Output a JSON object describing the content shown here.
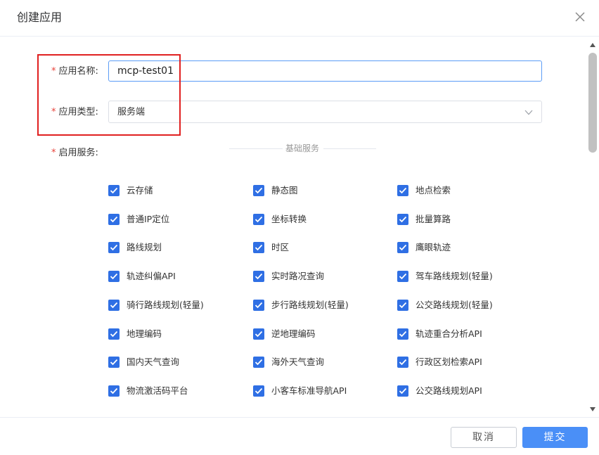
{
  "dialog": {
    "title": "创建应用"
  },
  "form": {
    "app_name_label": "应用名称:",
    "app_name_value": "mcp-test01",
    "app_type_label": "应用类型:",
    "app_type_value": "服务端",
    "services_label": "启用服务:",
    "required_mark": "*"
  },
  "services": {
    "section_title": "基础服务",
    "items": [
      {
        "label": "云存储",
        "checked": true
      },
      {
        "label": "静态图",
        "checked": true
      },
      {
        "label": "地点检索",
        "checked": true
      },
      {
        "label": "普通IP定位",
        "checked": true
      },
      {
        "label": "坐标转换",
        "checked": true
      },
      {
        "label": "批量算路",
        "checked": true
      },
      {
        "label": "路线规划",
        "checked": true
      },
      {
        "label": "时区",
        "checked": true
      },
      {
        "label": "鹰眼轨迹",
        "checked": true
      },
      {
        "label": "轨迹纠偏API",
        "checked": true
      },
      {
        "label": "实时路况查询",
        "checked": true
      },
      {
        "label": "驾车路线规划(轻量)",
        "checked": true
      },
      {
        "label": "骑行路线规划(轻量)",
        "checked": true
      },
      {
        "label": "步行路线规划(轻量)",
        "checked": true
      },
      {
        "label": "公交路线规划(轻量)",
        "checked": true
      },
      {
        "label": "地理编码",
        "checked": true
      },
      {
        "label": "逆地理编码",
        "checked": true
      },
      {
        "label": "轨迹重合分析API",
        "checked": true
      },
      {
        "label": "国内天气查询",
        "checked": true
      },
      {
        "label": "海外天气查询",
        "checked": true
      },
      {
        "label": "行政区划检索API",
        "checked": true
      },
      {
        "label": "物流激活码平台",
        "checked": true
      },
      {
        "label": "小客车标准导航API",
        "checked": true
      },
      {
        "label": "公交路线规划API",
        "checked": true
      }
    ]
  },
  "footer": {
    "cancel_label": "取消",
    "submit_label": "提交"
  },
  "colors": {
    "primary": "#4a8ff7",
    "checkbox": "#2f6fe4",
    "required": "#e8433b",
    "highlight": "#e02020"
  }
}
